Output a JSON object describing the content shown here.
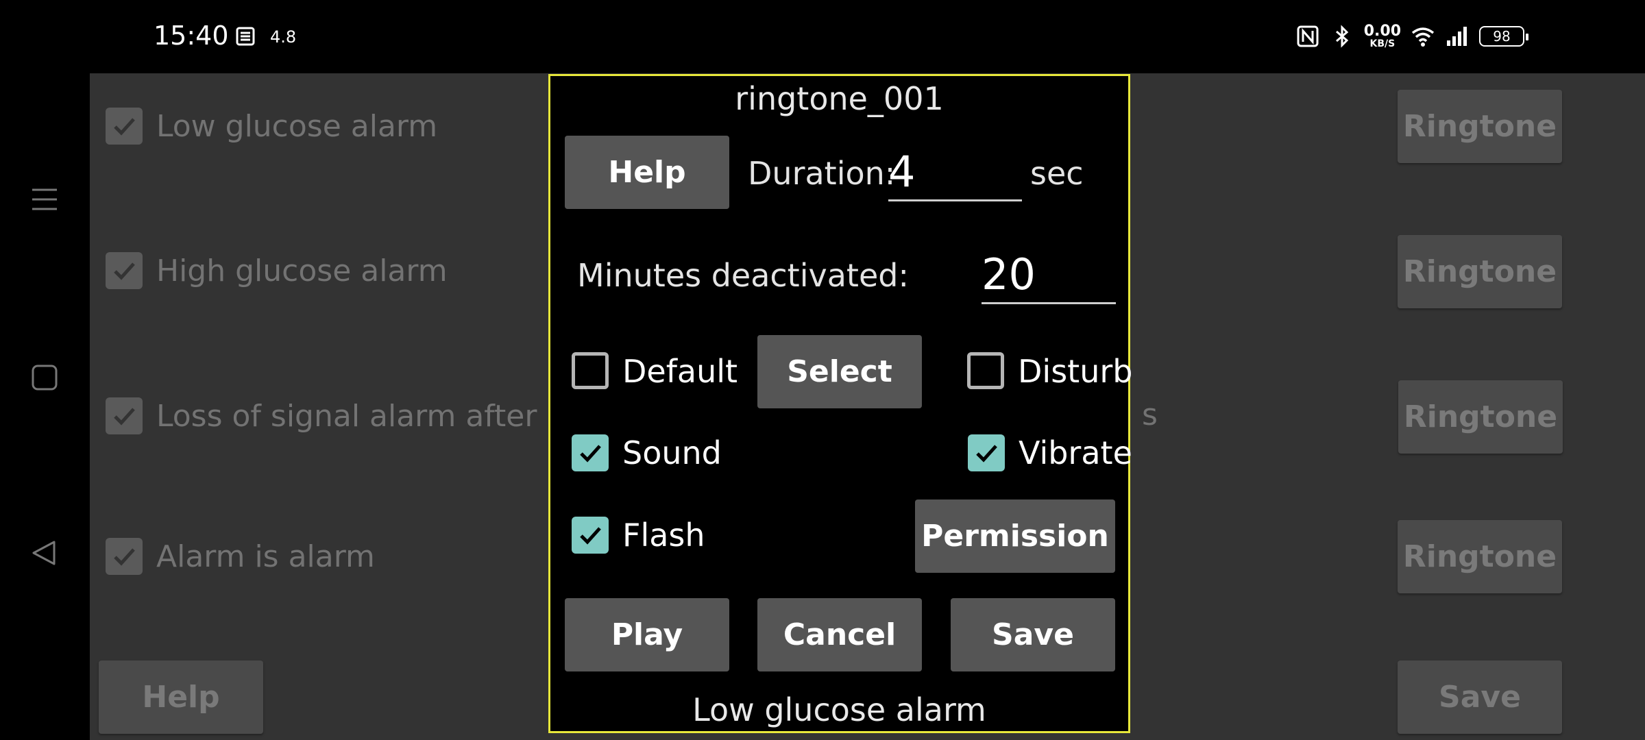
{
  "status_bar": {
    "time": "15:40",
    "notification_value": "4.8",
    "net_speed_value": "0.00",
    "net_speed_unit": "KB/S",
    "battery": "98"
  },
  "nav": {
    "icons": [
      "menu-icon",
      "home-square-icon",
      "back-triangle-icon"
    ]
  },
  "background": {
    "rows": [
      {
        "label": "Low glucose alarm",
        "checked": true
      },
      {
        "label": "High glucose alarm",
        "checked": true
      },
      {
        "label": "Loss of signal alarm after",
        "checked": true
      },
      {
        "label": "Alarm is alarm",
        "checked": true
      }
    ],
    "ringtone_label": "Ringtone",
    "partial_text": "s",
    "help_label": "Help",
    "save_label": "Save"
  },
  "dialog": {
    "title": "ringtone_001",
    "help_label": "Help",
    "duration_label": "Duration:",
    "duration_value": "4",
    "duration_unit": "sec",
    "minutes_label": "Minutes deactivated:",
    "minutes_value": "20",
    "default_label": "Default",
    "default_checked": false,
    "select_label": "Select",
    "disturb_label": "Disturb",
    "disturb_checked": false,
    "sound_label": "Sound",
    "sound_checked": true,
    "vibrate_label": "Vibrate",
    "vibrate_checked": true,
    "flash_label": "Flash",
    "flash_checked": true,
    "permission_label": "Permission",
    "play_label": "Play",
    "cancel_label": "Cancel",
    "save_label": "Save",
    "footer": "Low glucose alarm"
  },
  "colors": {
    "dialog_border": "#e7e73a",
    "checkbox_accent": "#80cbc4",
    "button_bg": "#555555",
    "background_app": "#333333"
  }
}
